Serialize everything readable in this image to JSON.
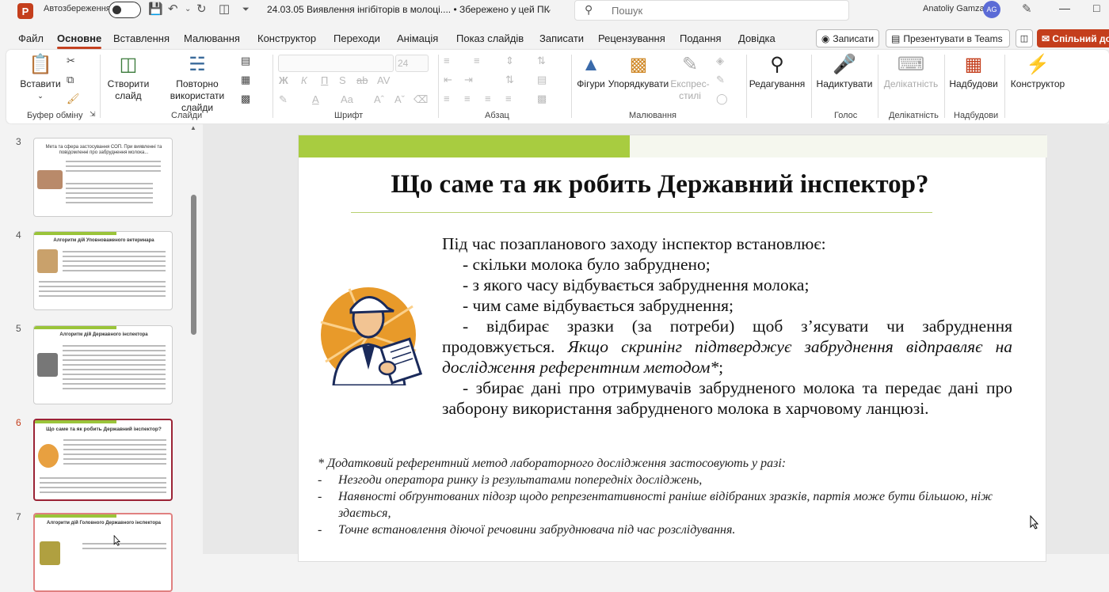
{
  "window": {
    "app_logo": "P",
    "autosave_label": "Автозбереження",
    "doc_title": "24.03.05 Виявлення інгібіторів в молоці....  •  Збережено у цей ПК",
    "search_placeholder": "Пошук",
    "user_name": "Anatoliy Gamza",
    "user_initials": "AG"
  },
  "menu": {
    "items": [
      "Файл",
      "Основне",
      "Вставлення",
      "Малювання",
      "Конструктор",
      "Переходи",
      "Анімація",
      "Показ слайдів",
      "Записати",
      "Рецензування",
      "Подання",
      "Довідка"
    ],
    "active": "Основне",
    "record_label": "Записати",
    "present_label": "Презентувати в Teams",
    "share_label": "Спільний до"
  },
  "ribbon": {
    "paste": "Вставити",
    "new_slide": "Створити слайд",
    "reuse_slides": "Повторно використати слайди",
    "font_size": "24",
    "shapes": "Фігури",
    "arrange": "Упорядкувати",
    "quick_styles": "Експрес-стилі",
    "editing": "Редагування",
    "dictate": "Надиктувати",
    "sensitivity": "Делікатність",
    "addins": "Надбудови",
    "designer": "Конструктор",
    "groups": {
      "clipboard": "Буфер обміну",
      "slides": "Слайди",
      "font": "Шрифт",
      "paragraph": "Абзац",
      "drawing": "Малювання",
      "voice": "Голос",
      "sensitivity": "Делікатність",
      "addins": "Надбудови"
    }
  },
  "thumbnails": [
    {
      "num": "3",
      "title": "Мета та сфера застосування СОП. При виявленні та повідомленні про забруднення молока..."
    },
    {
      "num": "4",
      "title": "Алгоритм дій Уповноваженого ветеринара"
    },
    {
      "num": "5",
      "title": "Алгоритм дій Державного інспектора"
    },
    {
      "num": "6",
      "title": "Що саме та як робить Державний інспектор?"
    },
    {
      "num": "7",
      "title": "Алгоритм дій Головного Державного інспектора"
    }
  ],
  "slide": {
    "title": "Що саме та як робить Державний інспектор?",
    "intro": "Під час позапланового заходу інспектор встановлює:",
    "items": [
      "- скільки молока було забруднено;",
      "- з якого часу відбувається забруднення молока;",
      "- чим саме відбувається забруднення;"
    ],
    "sampling_normal": "- відбирає зразки (за потреби) щоб з’ясувати чи забруднення продовжується.",
    "sampling_italic": " Якщо скринінг підтверджує забруднення відправляє на дослідження референтним методом*",
    "sampling_end": ";",
    "data_item": "- збирає дані про отримувачів забрудненого молока та передає дані про заборону використання забрудненого молока в харчовому ланцюзі.",
    "footnote_intro": "* Додатковий референтний метод лабораторного дослідження застосовують у разі:",
    "footnote_items": [
      "Незгоди оператора ринку із результатами попередніх досліджень,",
      "Наявності обґрунтованих підозр щодо репрезентативності раніше відібраних зразків, партія може бути більшою, ніж здається,",
      "Точне встановлення діючої речовини забруднювача під час розслідування."
    ],
    "footnote_dash": "-"
  }
}
